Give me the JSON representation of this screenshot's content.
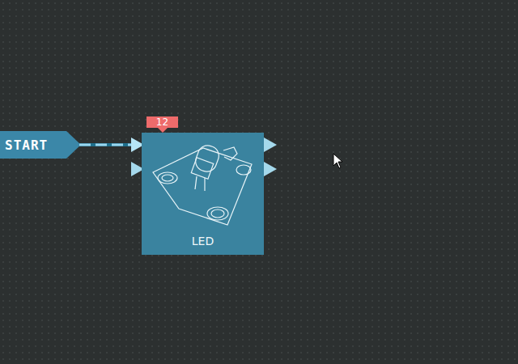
{
  "canvas": {
    "start": {
      "label": "START",
      "connected": true
    },
    "nodes": [
      {
        "label": "LED",
        "badge": "12",
        "inputs": [
          {
            "connected": true
          },
          {
            "connected": false
          }
        ],
        "outputs": [
          {
            "connected": false
          },
          {
            "connected": false
          }
        ]
      }
    ]
  }
}
